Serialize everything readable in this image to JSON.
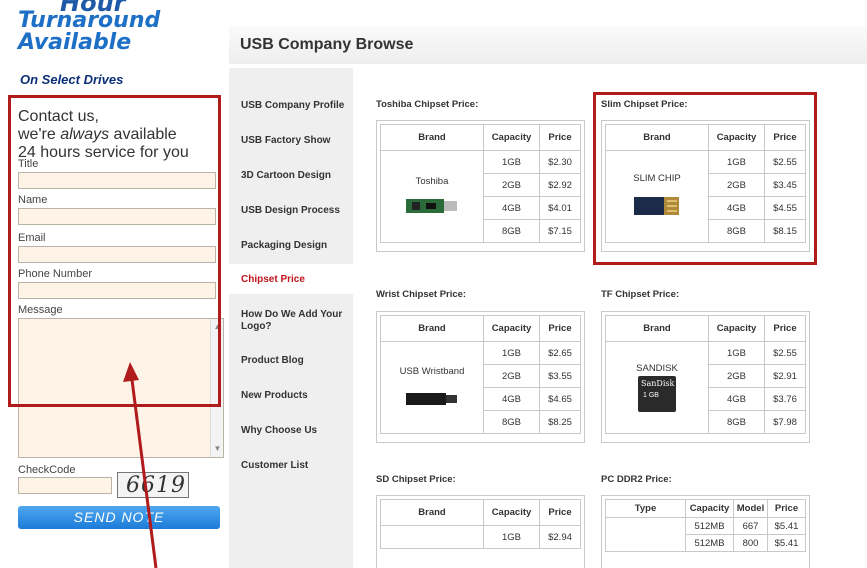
{
  "promo": {
    "hour": "Hour",
    "turnaround": "Turnaround",
    "available": "Available",
    "select": "On Select Drives"
  },
  "form": {
    "heading_1": "Contact us,",
    "heading_2a": "we're ",
    "heading_2b": "always",
    "heading_2c": " available",
    "heading_3": "24 hours service for you",
    "title_label": "Title",
    "name_label": "Name",
    "email_label": "Email",
    "phone_label": "Phone Number",
    "message_label": "Message",
    "checkcode_label": "CheckCode",
    "captcha_text": "6619",
    "send_label": "SEND NOTE"
  },
  "header": {
    "title": "USB Company Browse"
  },
  "nav": {
    "items": [
      "USB Company Profile",
      "USB Factory Show",
      "3D Cartoon Design",
      "USB Design Process",
      "Packaging Design",
      "Chipset Price",
      "How Do We Add Your Logo?",
      "Product Blog",
      "New Products",
      "Why Choose Us",
      "Customer List"
    ],
    "active_index": 5
  },
  "tables": {
    "headers": {
      "brand": "Brand",
      "capacity": "Capacity",
      "price": "Price",
      "type": "Type",
      "model": "Model"
    },
    "toshiba": {
      "title": "Toshiba Chipset Price:",
      "brand": "Toshiba",
      "rows": [
        [
          "1GB",
          "$2.30"
        ],
        [
          "2GB",
          "$2.92"
        ],
        [
          "4GB",
          "$4.01"
        ],
        [
          "8GB",
          "$7.15"
        ]
      ]
    },
    "slim": {
      "title": "Slim Chipset Price:",
      "brand": "SLIM CHIP",
      "rows": [
        [
          "1GB",
          "$2.55"
        ],
        [
          "2GB",
          "$3.45"
        ],
        [
          "4GB",
          "$4.55"
        ],
        [
          "8GB",
          "$8.15"
        ]
      ]
    },
    "wrist": {
      "title": "Wrist Chipset Price:",
      "brand": "USB Wristband",
      "rows": [
        [
          "1GB",
          "$2.65"
        ],
        [
          "2GB",
          "$3.55"
        ],
        [
          "4GB",
          "$4.65"
        ],
        [
          "8GB",
          "$8.25"
        ]
      ]
    },
    "tf": {
      "title": "TF Chipset Price:",
      "brand": "SANDISK",
      "sd_logo": "SanDisk",
      "sd_sub": "1 GB",
      "rows": [
        [
          "1GB",
          "$2.55"
        ],
        [
          "2GB",
          "$2.91"
        ],
        [
          "4GB",
          "$3.76"
        ],
        [
          "8GB",
          "$7.98"
        ]
      ]
    },
    "sd": {
      "title": "SD Chipset Price:",
      "rows": [
        [
          "1GB",
          "$2.94"
        ]
      ]
    },
    "ddr2": {
      "title": "PC DDR2 Price:",
      "rows": [
        [
          "512MB",
          "667",
          "$5.41"
        ],
        [
          "512MB",
          "800",
          "$5.41"
        ]
      ]
    }
  },
  "colors": {
    "accent_red": "#b01b1b",
    "nav_active": "#c0151b",
    "button_blue": "#1d7bd8",
    "promo_blue": "#1e6fc6"
  }
}
